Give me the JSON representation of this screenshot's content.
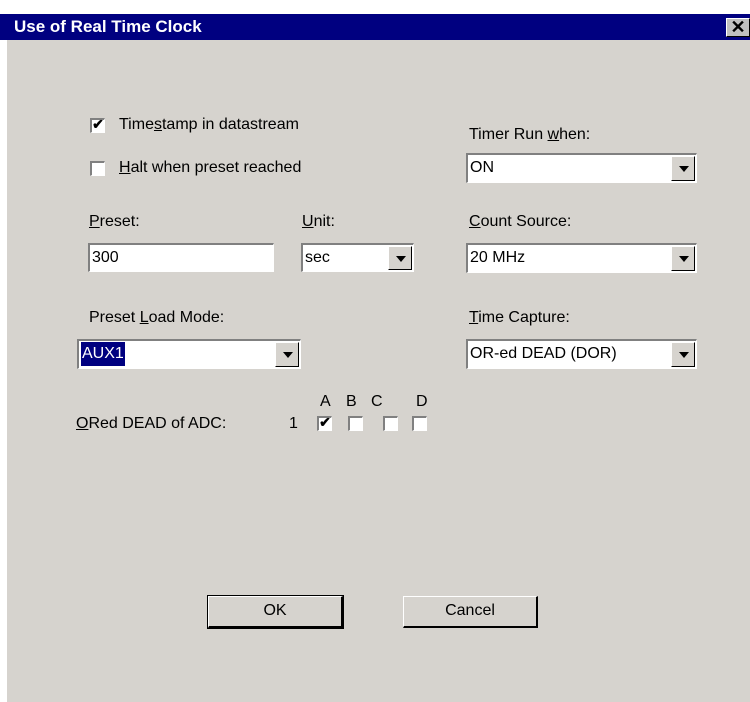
{
  "window": {
    "title": "Use of Real Time Clock",
    "close_glyph": "✕"
  },
  "options": {
    "timestamp": {
      "label_pre": "Time",
      "label_accel": "s",
      "label_post": "tamp in datastream",
      "checked": true
    },
    "halt": {
      "label_pre": "",
      "label_accel": "H",
      "label_post": "alt when preset reached",
      "checked": false
    }
  },
  "preset": {
    "label_accel": "P",
    "label_post": "reset:",
    "value": "300"
  },
  "unit": {
    "label_accel": "U",
    "label_post": "nit:",
    "value": "sec"
  },
  "preset_load_mode": {
    "label_pre": "Preset ",
    "label_accel": "L",
    "label_post": "oad Mode:",
    "value": "AUX1"
  },
  "timer_run": {
    "label_pre": "Timer Run ",
    "label_accel": "w",
    "label_post": "hen:",
    "value": "ON"
  },
  "count_source": {
    "label_accel": "C",
    "label_post": "ount Source:",
    "value": "20 MHz"
  },
  "time_capture": {
    "label_accel": "T",
    "label_post": "ime Capture:",
    "value": "OR-ed DEAD (DOR)"
  },
  "ored_dead": {
    "label_accel": "O",
    "label_post": "Red DEAD of ADC:",
    "adc_number": "1",
    "channels": [
      {
        "label": "A",
        "checked": true
      },
      {
        "label": "B",
        "checked": false
      },
      {
        "label": "C",
        "checked": false
      },
      {
        "label": "D",
        "checked": false
      }
    ]
  },
  "buttons": {
    "ok": "OK",
    "cancel": "Cancel"
  },
  "colors": {
    "title_bar": "#000080",
    "dialog_face": "#d6d3ce",
    "selection": "#000080"
  }
}
